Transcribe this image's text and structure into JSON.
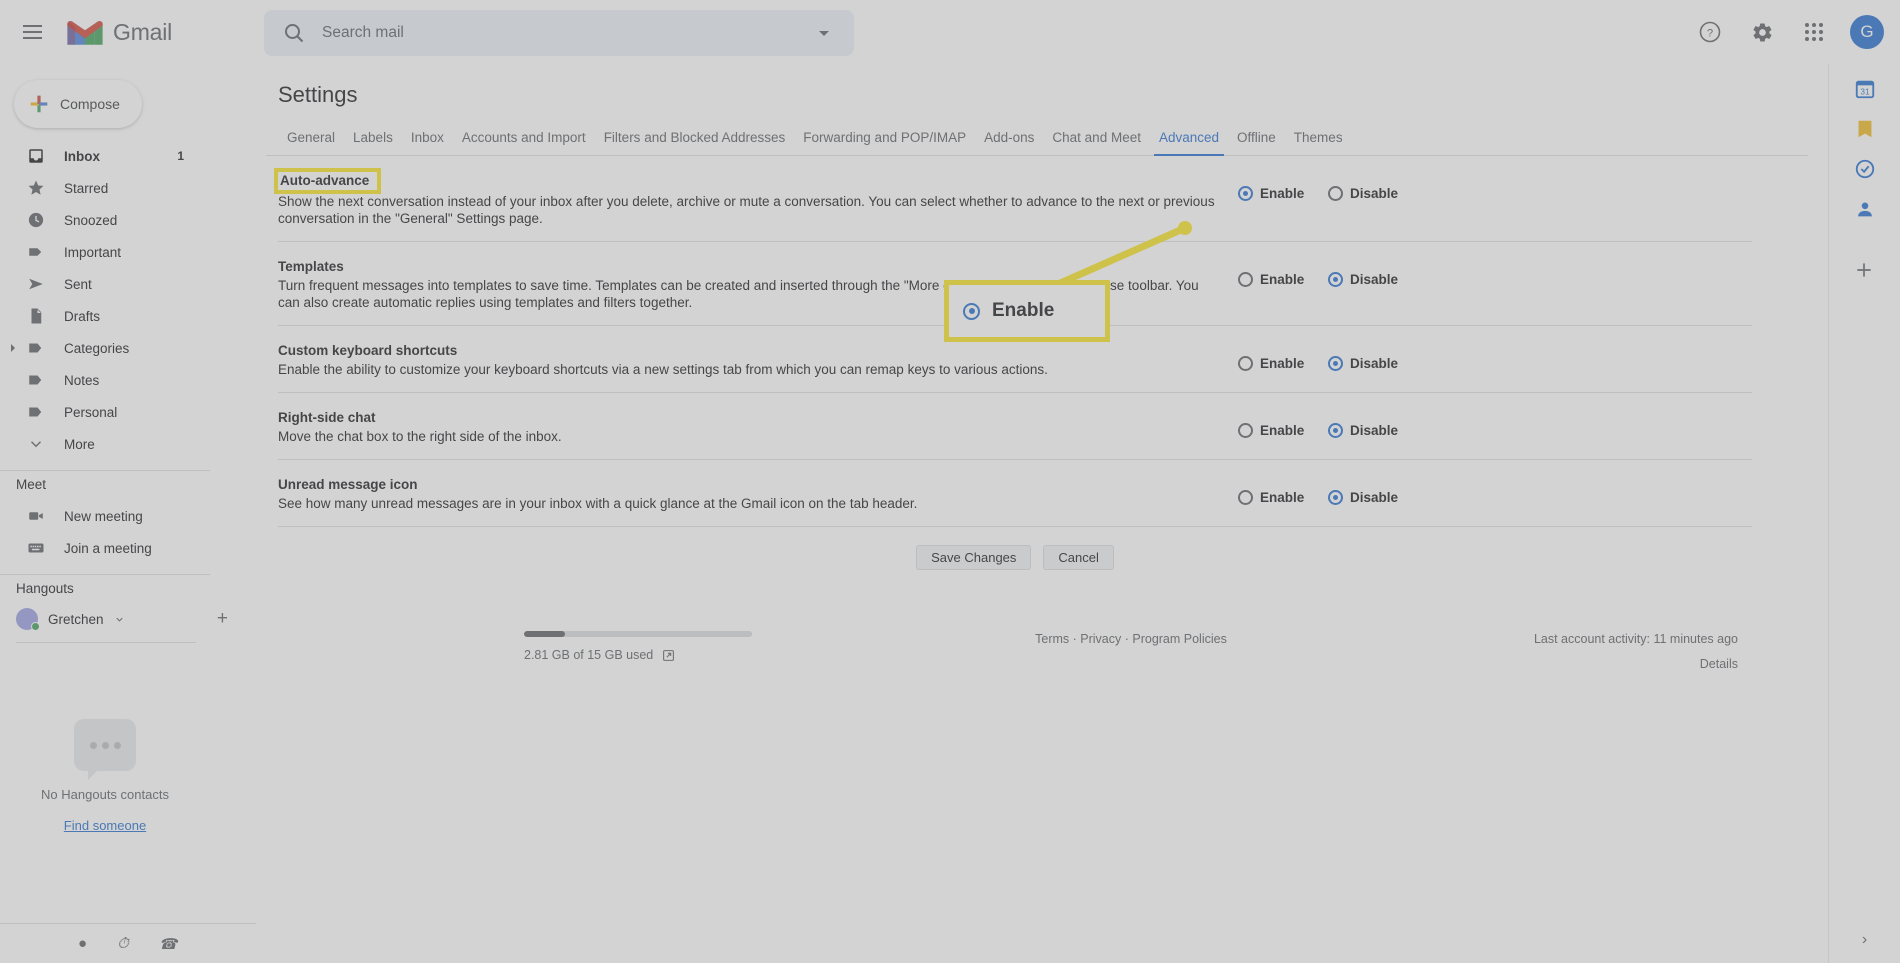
{
  "app": {
    "brand": "Gmail",
    "menu_icon": "hamburger-icon",
    "avatar_letter": "G"
  },
  "search": {
    "placeholder": "Search mail",
    "value": "",
    "icon": "search-icon",
    "options_icon": "chevron-down-icon"
  },
  "topbar_actions": [
    {
      "name": "help-icon",
      "label": "?"
    },
    {
      "name": "settings-gear-icon",
      "label": "⚙"
    },
    {
      "name": "google-apps-grid-icon",
      "label": "apps"
    }
  ],
  "sidebar": {
    "compose_label": "Compose",
    "items": [
      {
        "label": "Inbox",
        "icon": "inbox-icon",
        "count": "1",
        "selected": true
      },
      {
        "label": "Starred",
        "icon": "star-icon",
        "count": "",
        "selected": false
      },
      {
        "label": "Snoozed",
        "icon": "clock-icon",
        "count": "",
        "selected": false
      },
      {
        "label": "Important",
        "icon": "important-label-icon",
        "count": "",
        "selected": false
      },
      {
        "label": "Sent",
        "icon": "send-icon",
        "count": "",
        "selected": false
      },
      {
        "label": "Drafts",
        "icon": "draft-document-icon",
        "count": "",
        "selected": false
      },
      {
        "label": "Categories",
        "icon": "tag-icon",
        "count": "",
        "selected": false,
        "expandable": true
      },
      {
        "label": "Notes",
        "icon": "tag-icon",
        "count": "",
        "selected": false
      },
      {
        "label": "Personal",
        "icon": "tag-icon",
        "count": "",
        "selected": false
      },
      {
        "label": "More",
        "icon": "chevron-down-icon",
        "count": "",
        "selected": false
      }
    ],
    "meet": {
      "title": "Meet",
      "items": [
        {
          "label": "New meeting",
          "icon": "video-camera-icon"
        },
        {
          "label": "Join a meeting",
          "icon": "keyboard-icon"
        }
      ]
    },
    "hangouts": {
      "title": "Hangouts",
      "user": "Gretchen",
      "user_caret": "chevron-down-icon",
      "add_icon": "plus-icon",
      "empty_text": "No Hangouts contacts",
      "find_link": "Find someone"
    }
  },
  "main": {
    "page_title": "Settings",
    "tabs": [
      {
        "label": "General",
        "active": false
      },
      {
        "label": "Labels",
        "active": false
      },
      {
        "label": "Inbox",
        "active": false
      },
      {
        "label": "Accounts and Import",
        "active": false
      },
      {
        "label": "Filters and Blocked Addresses",
        "active": false
      },
      {
        "label": "Forwarding and POP/IMAP",
        "active": false
      },
      {
        "label": "Add-ons",
        "active": false
      },
      {
        "label": "Chat and Meet",
        "active": false
      },
      {
        "label": "Advanced",
        "active": true
      },
      {
        "label": "Offline",
        "active": false
      },
      {
        "label": "Themes",
        "active": false
      }
    ],
    "settings": [
      {
        "name": "Auto-advance",
        "highlighted": true,
        "description": "Show the next conversation instead of your inbox after you delete, archive or mute a conversation. You can select whether to advance to the next or previous conversation in the \"General\" Settings page.",
        "enable_label": "Enable",
        "disable_label": "Disable",
        "selected": "enable"
      },
      {
        "name": "Templates",
        "highlighted": false,
        "description": "Turn frequent messages into templates to save time. Templates can be created and inserted through the \"More options\" menu in the compose toolbar. You can also create automatic replies using templates and filters together.",
        "enable_label": "Enable",
        "disable_label": "Disable",
        "selected": "disable"
      },
      {
        "name": "Custom keyboard shortcuts",
        "highlighted": false,
        "description": "Enable the ability to customize your keyboard shortcuts via a new settings tab from which you can remap keys to various actions.",
        "enable_label": "Enable",
        "disable_label": "Disable",
        "selected": "disable"
      },
      {
        "name": "Right-side chat",
        "highlighted": false,
        "description": "Move the chat box to the right side of the inbox.",
        "enable_label": "Enable",
        "disable_label": "Disable",
        "selected": "disable"
      },
      {
        "name": "Unread message icon",
        "highlighted": false,
        "description": "See how many unread messages are in your inbox with a quick glance at the Gmail icon on the tab header.",
        "enable_label": "Enable",
        "disable_label": "Disable",
        "selected": "disable"
      }
    ],
    "save_label": "Save Changes",
    "cancel_label": "Cancel"
  },
  "footer": {
    "storage_text": "2.81 GB of 15 GB used",
    "storage_percent": 18,
    "storage_icon": "external-link-icon",
    "links": "Terms · Privacy · Program Policies",
    "activity": "Last account activity: 11 minutes ago",
    "details": "Details"
  },
  "right_rail": [
    {
      "name": "google-calendar-icon",
      "color": "#1a73e8"
    },
    {
      "name": "google-keep-icon",
      "color": "#fbbc04"
    },
    {
      "name": "google-tasks-icon",
      "color": "#1a73e8"
    },
    {
      "name": "google-contacts-icon",
      "color": "#1a73e8"
    },
    {
      "name": "add-addon-icon",
      "color": "#5f6368"
    }
  ],
  "annotation": {
    "callout_label": "Enable",
    "callout_radio_state": "checked",
    "highlight_color": "#ffe600"
  }
}
